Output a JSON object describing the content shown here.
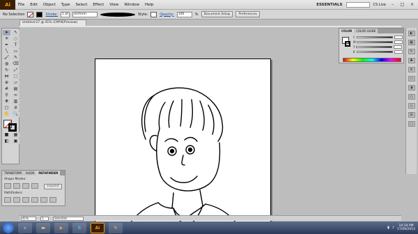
{
  "menubar": {
    "logo": "Ai",
    "items": [
      "File",
      "Edit",
      "Object",
      "Type",
      "Select",
      "Effect",
      "View",
      "Window",
      "Help"
    ],
    "workspace": "ESSENTIALS",
    "cslive": "CS Live"
  },
  "controlbar": {
    "selection": "No Selection",
    "stroke_label": "Stroke:",
    "stroke_weight": "1 pt",
    "profile": "Uniform",
    "style_label": "Style:",
    "opacity_label": "Opacity:",
    "opacity_value": "100",
    "percent": "%",
    "doc_setup": "Document Setup",
    "preferences": "Preferences"
  },
  "document": {
    "tab": "Untitled-27 @ 41% (CMYK/Preview)"
  },
  "color_panel": {
    "tab_color": "COLOR",
    "tab_guide": "COLOR GUIDE",
    "channels": [
      "C",
      "M",
      "Y",
      "K"
    ]
  },
  "pathfinder_panel": {
    "tab_transform": "TRANSFORM",
    "tab_align": "ALIGN",
    "tab_pathfinder": "PATHFINDER",
    "shape_modes": "Shape Modes:",
    "pathfinders": "Pathfinders:",
    "expand": "Expand"
  },
  "status": {
    "zoom": "41%",
    "page": "1",
    "mode": "Selection"
  },
  "taskbar": {
    "ai_label": "Ai",
    "time": "10:34 PM",
    "date": "17/09/2014"
  },
  "colors": {
    "accent": "#ff9a00",
    "panel": "#d4d4d4",
    "canvas_bg": "#bdbdbd"
  }
}
